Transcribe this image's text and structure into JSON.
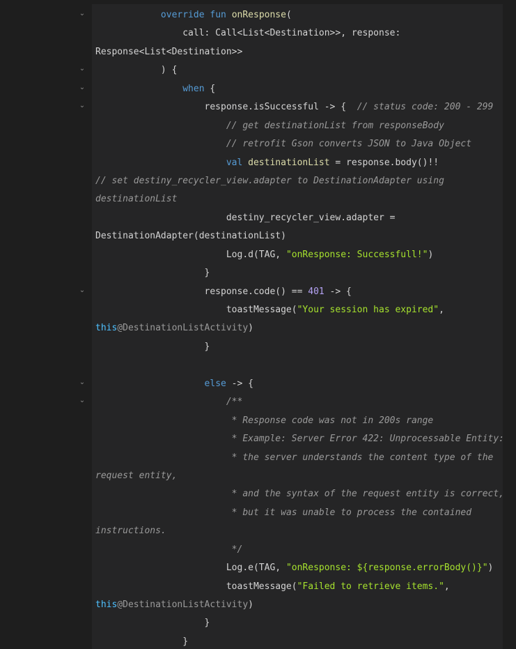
{
  "editor": {
    "lines": [
      [
        {
          "t": "            "
        },
        {
          "t": "override",
          "c": "kw"
        },
        {
          "t": " "
        },
        {
          "t": "fun",
          "c": "kw"
        },
        {
          "t": " "
        },
        {
          "t": "onResponse",
          "c": "fn"
        },
        {
          "t": "("
        }
      ],
      [
        {
          "t": "                call: Call<List<Destination>>, response:"
        }
      ],
      [
        {
          "t": "Response<List<Destination>>"
        }
      ],
      [
        {
          "t": "            ) {"
        }
      ],
      [
        {
          "t": "                "
        },
        {
          "t": "when",
          "c": "kw"
        },
        {
          "t": " {"
        }
      ],
      [
        {
          "t": "                    response.isSuccessful -> {  "
        },
        {
          "t": "// status code: 200 - 299",
          "c": "cm"
        }
      ],
      [
        {
          "t": "                        "
        },
        {
          "t": "// get destinationList from responseBody",
          "c": "cm"
        }
      ],
      [
        {
          "t": "                        "
        },
        {
          "t": "// retrofit Gson converts JSON to Java Object",
          "c": "cm"
        }
      ],
      [
        {
          "t": "                        "
        },
        {
          "t": "val",
          "c": "kw"
        },
        {
          "t": " "
        },
        {
          "t": "destinationList",
          "c": "fn"
        },
        {
          "t": " = response.body()!!"
        }
      ],
      [
        {
          "t": "// set destiny_recycler_view.adapter to DestinationAdapter using",
          "c": "cm"
        }
      ],
      [
        {
          "t": "destinationList",
          "c": "cm"
        }
      ],
      [
        {
          "t": "                        destiny_recycler_view.adapter ="
        }
      ],
      [
        {
          "t": "DestinationAdapter(destinationList)"
        }
      ],
      [
        {
          "t": "                        Log.d(TAG, "
        },
        {
          "t": "\"onResponse: Successfull!\"",
          "c": "str"
        },
        {
          "t": ")"
        }
      ],
      [
        {
          "t": "                    }"
        }
      ],
      [
        {
          "t": "                    response.code() == "
        },
        {
          "t": "401",
          "c": "num"
        },
        {
          "t": " -> {"
        }
      ],
      [
        {
          "t": "                        toastMessage("
        },
        {
          "t": "\"Your session has expired\"",
          "c": "str"
        },
        {
          "t": ","
        }
      ],
      [
        {
          "t": "this",
          "c": "this"
        },
        {
          "t": "@DestinationListActivity",
          "c": "ann"
        },
        {
          "t": ")"
        }
      ],
      [
        {
          "t": "                    }"
        }
      ],
      [
        {
          "t": ""
        }
      ],
      [
        {
          "t": "                    "
        },
        {
          "t": "else",
          "c": "kw"
        },
        {
          "t": " -> {"
        }
      ],
      [
        {
          "t": "                        "
        },
        {
          "t": "/**",
          "c": "cm"
        }
      ],
      [
        {
          "t": "                         "
        },
        {
          "t": "* Response code was not in 200s range",
          "c": "cm"
        }
      ],
      [
        {
          "t": "                         "
        },
        {
          "t": "* Example: Server Error 422: Unprocessable Entity:",
          "c": "cm"
        }
      ],
      [
        {
          "t": "                         "
        },
        {
          "t": "* the server understands the content type of the",
          "c": "cm"
        }
      ],
      [
        {
          "t": "request entity,",
          "c": "cm"
        }
      ],
      [
        {
          "t": "                         "
        },
        {
          "t": "* and the syntax of the request entity is correct,",
          "c": "cm"
        }
      ],
      [
        {
          "t": "                         "
        },
        {
          "t": "* but it was unable to process the contained",
          "c": "cm"
        }
      ],
      [
        {
          "t": "instructions.",
          "c": "cm"
        }
      ],
      [
        {
          "t": "                         "
        },
        {
          "t": "*/",
          "c": "cm"
        }
      ],
      [
        {
          "t": "                        Log.e(TAG, "
        },
        {
          "t": "\"onResponse: ${response.errorBody()}\"",
          "c": "str"
        },
        {
          "t": ")"
        }
      ],
      [
        {
          "t": "                        toastMessage("
        },
        {
          "t": "\"Failed to retrieve items.\"",
          "c": "str"
        },
        {
          "t": ","
        }
      ],
      [
        {
          "t": "this",
          "c": "this"
        },
        {
          "t": "@DestinationListActivity",
          "c": "ann"
        },
        {
          "t": ")"
        }
      ],
      [
        {
          "t": "                    }"
        }
      ],
      [
        {
          "t": "                }"
        }
      ]
    ],
    "fold_markers": [
      0,
      3,
      4,
      5,
      15,
      20,
      21
    ],
    "fold_icon": "chevron-down-icon",
    "fold_glyph": "⌄",
    "colors": {
      "background": "#1e1e1e",
      "panel": "#252526",
      "keyword": "#569cd6",
      "function": "#dcdcaa",
      "string": "#a6e22e",
      "number": "#b5a3f5",
      "comment": "#9a9a9a",
      "this": "#4fc1ff"
    }
  }
}
